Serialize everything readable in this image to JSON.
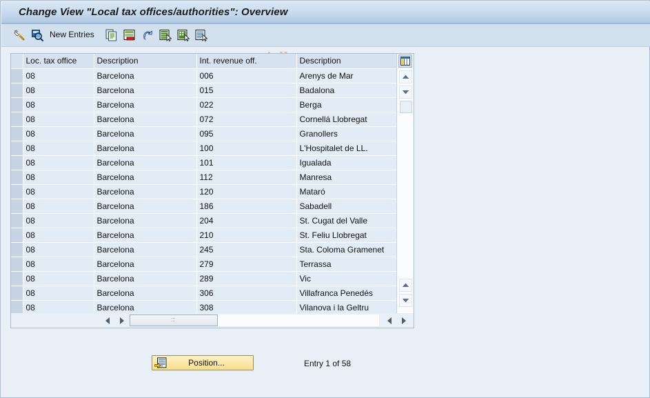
{
  "window": {
    "title": "Change View \"Local tax offices/authorities\": Overview"
  },
  "toolbar": {
    "new_entries_label": "New Entries",
    "icons": [
      {
        "name": "pencil-display-change-icon",
        "title": "Display/Change"
      },
      {
        "name": "magnifier-check-icon",
        "title": "Check"
      },
      {
        "name": "copy-icon",
        "title": "Copy As..."
      },
      {
        "name": "delete-row-icon",
        "title": "Delete"
      },
      {
        "name": "undo-icon",
        "title": "Undo Change"
      },
      {
        "name": "select-all-icon",
        "title": "Select All"
      },
      {
        "name": "deselect-all-icon",
        "title": "Deselect All"
      },
      {
        "name": "select-block-icon",
        "title": "Select Block"
      }
    ]
  },
  "watermark": {
    "text": "www.tutorialkart.com",
    "color": "#edbd8d"
  },
  "table": {
    "columns": [
      "Loc. tax office",
      "Description",
      "Int. revenue off.",
      "Description"
    ],
    "rows": [
      [
        "08",
        "Barcelona",
        "006",
        "Arenys de Mar"
      ],
      [
        "08",
        "Barcelona",
        "015",
        "Badalona"
      ],
      [
        "08",
        "Barcelona",
        "022",
        "Berga"
      ],
      [
        "08",
        "Barcelona",
        "072",
        "Cornellá Llobregat"
      ],
      [
        "08",
        "Barcelona",
        "095",
        "Granollers"
      ],
      [
        "08",
        "Barcelona",
        "100",
        "L'Hospitalet de LL."
      ],
      [
        "08",
        "Barcelona",
        "101",
        "Igualada"
      ],
      [
        "08",
        "Barcelona",
        "112",
        "Manresa"
      ],
      [
        "08",
        "Barcelona",
        "120",
        "Mataró"
      ],
      [
        "08",
        "Barcelona",
        "186",
        "Sabadell"
      ],
      [
        "08",
        "Barcelona",
        "204",
        "St. Cugat del Valle"
      ],
      [
        "08",
        "Barcelona",
        "210",
        "St. Feliu Llobregat"
      ],
      [
        "08",
        "Barcelona",
        "245",
        "Sta. Coloma Gramenet"
      ],
      [
        "08",
        "Barcelona",
        "279",
        "Terrassa"
      ],
      [
        "08",
        "Barcelona",
        "289",
        "Vic"
      ],
      [
        "08",
        "Barcelona",
        "306",
        "Villafranca Penedés"
      ],
      [
        "08",
        "Barcelona",
        "308",
        "Vilanova i la Geltru"
      ]
    ]
  },
  "footer": {
    "position_button_label": "Position...",
    "entry_counter": "Entry 1 of 58"
  },
  "colors": {
    "title_bar": "#b4cbe4",
    "toolbar": "#d3e0ee",
    "row_bg": "#e2ecf6",
    "header_bg": "#d6e2f0",
    "page_bg": "#e9eff7",
    "button_yellow": "#fbe9a8"
  }
}
